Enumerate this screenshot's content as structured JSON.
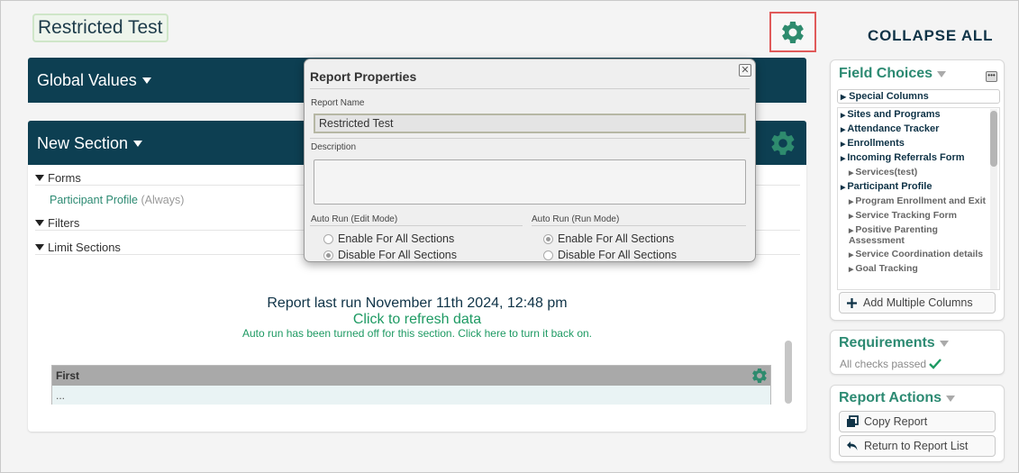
{
  "header": {
    "report_title": "Restricted Test",
    "collapse_all": "COLLAPSE ALL"
  },
  "global_values": {
    "title": "Global Values"
  },
  "section": {
    "title": "New Section",
    "forms_label": "Forms",
    "participant_profile": "Participant Profile",
    "always": "(Always)",
    "filters_label": "Filters",
    "limit_sections_label": "Limit Sections",
    "last_run": "Report last run November 11th 2024, 12:48 pm",
    "refresh": "Click to refresh data",
    "auto_run_off": "Auto run has been turned off for this section. Click here to turn it back on.",
    "grid": {
      "column_header": "First",
      "row_value": "..."
    }
  },
  "modal": {
    "title": "Report Properties",
    "close": "✕",
    "report_name_label": "Report Name",
    "report_name_value": "Restricted Test",
    "description_label": "Description",
    "auto_run_edit_label": "Auto Run (Edit Mode)",
    "auto_run_run_label": "Auto Run (Run Mode)",
    "enable_all": "Enable For All Sections",
    "disable_all": "Disable For All Sections",
    "edit_mode_selected": "Disable For All Sections",
    "run_mode_selected": "Enable For All Sections"
  },
  "field_choices": {
    "title": "Field Choices",
    "special_columns": "Special Columns",
    "items": [
      {
        "label": "Sites and Programs",
        "level": 0
      },
      {
        "label": "Attendance Tracker",
        "level": 0
      },
      {
        "label": "Enrollments",
        "level": 0
      },
      {
        "label": "Incoming Referrals Form",
        "level": 0
      },
      {
        "label": "Services(test)",
        "level": 1
      },
      {
        "label": "Participant Profile",
        "level": 0
      },
      {
        "label": "Program Enrollment and Exit",
        "level": 1
      },
      {
        "label": "Service Tracking Form",
        "level": 1
      },
      {
        "label": "Positive Parenting Assessment",
        "level": 1
      },
      {
        "label": "Service Coordination details",
        "level": 1
      },
      {
        "label": "Goal Tracking",
        "level": 1
      }
    ],
    "add_multiple": "Add Multiple Columns"
  },
  "requirements": {
    "title": "Requirements",
    "status": "All checks passed"
  },
  "report_actions": {
    "title": "Report Actions",
    "copy": "Copy Report",
    "return": "Return to Report List"
  },
  "colors": {
    "navy": "#0d3f52",
    "teal": "#2c8a72",
    "green": "#1e9a63",
    "gear": "#2e8b6e",
    "highlight": "#e05a5a"
  }
}
